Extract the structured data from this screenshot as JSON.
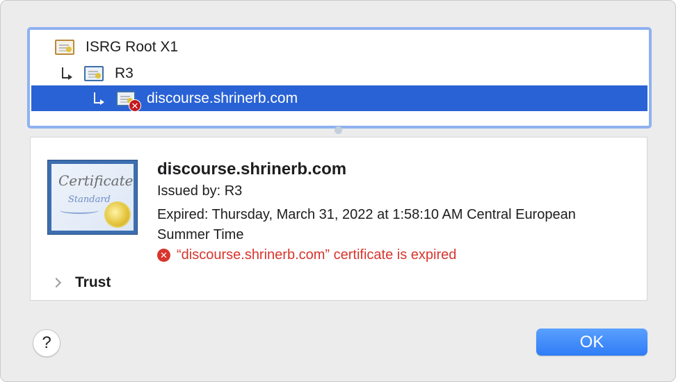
{
  "chain": {
    "items": [
      {
        "label": "ISRG Root X1",
        "icon": "certificate-root-icon"
      },
      {
        "label": "R3",
        "icon": "certificate-intermediate-icon"
      },
      {
        "label": "discourse.shrinerb.com",
        "icon": "certificate-invalid-icon",
        "selected": true
      }
    ]
  },
  "detail": {
    "common_name": "discourse.shrinerb.com",
    "issued_by": "Issued by: R3",
    "expired": "Expired: Thursday, March 31, 2022 at 1:58:10 AM Central European Summer Time",
    "error_message": "“discourse.shrinerb.com” certificate is expired",
    "trust_label": "Trust",
    "cert_art_text_1": "Certificate",
    "cert_art_text_2": "Standard"
  },
  "buttons": {
    "help": "?",
    "ok": "OK"
  },
  "colors": {
    "selection": "#2962d4",
    "error": "#d7352d",
    "ok_button": "#2f7cf6"
  }
}
